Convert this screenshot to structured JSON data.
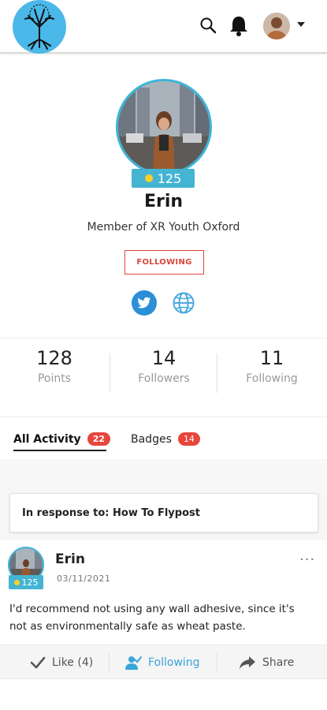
{
  "header": {
    "logo": "tree-logo",
    "icons": [
      "search-icon",
      "bell-icon"
    ],
    "accent": "#4ab8e8"
  },
  "profile": {
    "points_badge": "125",
    "name": "Erin",
    "member_of": "Member of XR Youth Oxford",
    "follow_button": "FOLLOWING",
    "links": [
      "twitter-icon",
      "globe-icon"
    ]
  },
  "stats": [
    {
      "value": "128",
      "label": "Points"
    },
    {
      "value": "14",
      "label": "Followers"
    },
    {
      "value": "11",
      "label": "Following"
    }
  ],
  "tabs": [
    {
      "label": "All Activity",
      "count": "22",
      "active": true
    },
    {
      "label": "Badges",
      "count": "14",
      "active": false
    }
  ],
  "feed": {
    "response_to": "In response to: How To Flypost",
    "post": {
      "author": "Erin",
      "badge": "125",
      "date": "03/11/2021",
      "more": "···",
      "body": "I'd recommend not using any wall adhesive, since it's not as environmentally safe as wheat paste."
    },
    "actions": {
      "like": "Like (4)",
      "following": "Following",
      "share": "Share"
    }
  },
  "colors": {
    "badge_blue": "#45b4d2",
    "count_red": "#e8453c",
    "follow_red": "#d8473d",
    "twitter_blue": "#2b8fd6"
  }
}
